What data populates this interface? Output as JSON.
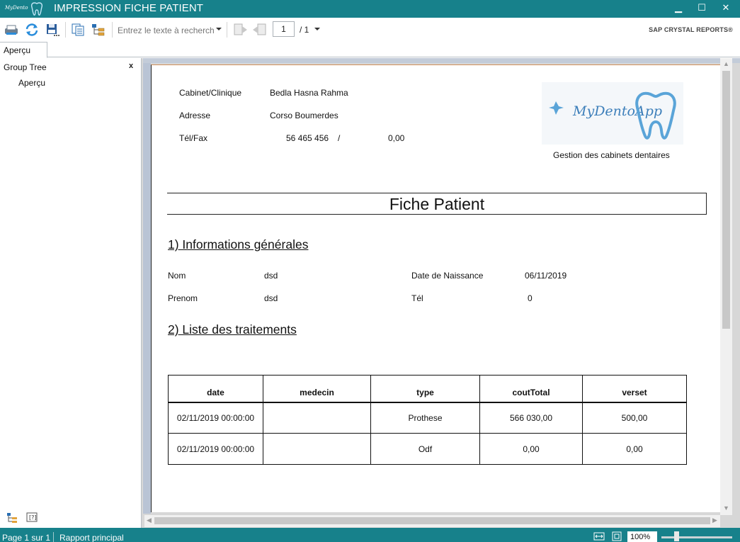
{
  "window": {
    "title": "IMPRESSION FICHE PATIENT",
    "logo_text": "MyDentoApp",
    "controls": {
      "minimize": "▁",
      "maximize": "☐",
      "close": "✕"
    }
  },
  "toolbar": {
    "search_placeholder": "Entrez le texte à recherch",
    "page_current": "1",
    "page_total": "/ 1",
    "brand": "SAP CRYSTAL REPORTS®"
  },
  "tabs": [
    {
      "label": "Aperçu"
    }
  ],
  "group_tree": {
    "title": "Group Tree",
    "close_label": "x",
    "items": [
      "Aperçu"
    ]
  },
  "report": {
    "header": {
      "cabinet_label": "Cabinet/Clinique",
      "cabinet_value": "Bedla Hasna Rahma",
      "adresse_label": "Adresse",
      "adresse_value": "Corso Boumerdes",
      "tel_label": "Tél/Fax",
      "tel_value": "56 465 456",
      "tel_sep": "/",
      "fax_value": "0,00"
    },
    "logo": {
      "name": "MyDentoApp",
      "caption": "Gestion des cabinets dentaires"
    },
    "title": "Fiche Patient",
    "section1": "1) Informations générales",
    "info": {
      "nom_label": "Nom",
      "nom_value": "dsd",
      "prenom_label": "Prenom",
      "prenom_value": "dsd",
      "dob_label": "Date de Naissance",
      "dob_value": "06/11/2019",
      "tel_label": "Tél",
      "tel_value": "0"
    },
    "section2": "2) Liste des traitements",
    "table": {
      "headers": [
        "date",
        "medecin",
        "type",
        "coutTotal",
        "verset"
      ],
      "rows": [
        [
          "02/11/2019  00:00:00",
          "",
          "Prothese",
          "566 030,00",
          "500,00"
        ],
        [
          "02/11/2019  00:00:00",
          "",
          "Odf",
          "0,00",
          "0,00"
        ]
      ]
    }
  },
  "status": {
    "page": "Page 1 sur 1",
    "report": "Rapport principal",
    "zoom": "100%"
  },
  "colors": {
    "titlebar": "#17818b",
    "statusbar": "#17818b",
    "logo_blue": "#5aa4d8"
  }
}
